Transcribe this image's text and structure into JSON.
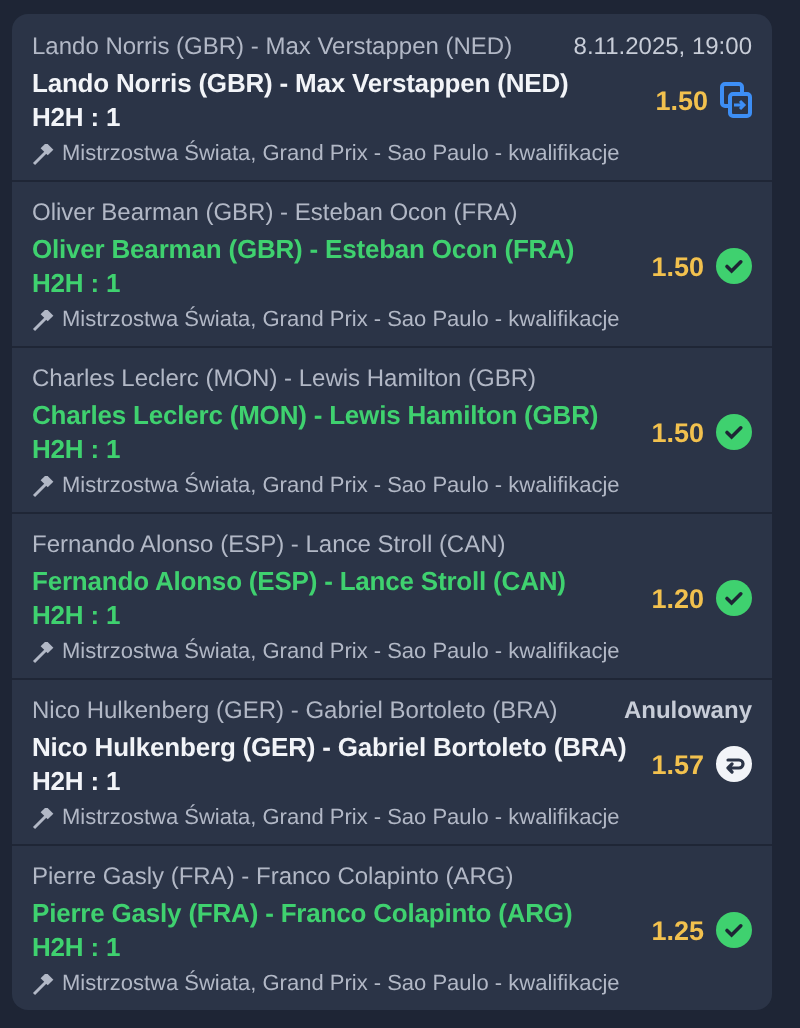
{
  "bets": [
    {
      "event": "Lando Norris (GBR) - Max Verstappen (NED)",
      "note": "8.11.2025, 19:00",
      "selection": "Lando Norris (GBR) - Max Verstappen (NED)",
      "market": "H2H : 1",
      "odds": "1.50",
      "kind": "pending",
      "league": "Mistrzostwa Świata, Grand Prix - Sao Paulo - kwalifikacje"
    },
    {
      "event": "Oliver Bearman (GBR) - Esteban Ocon (FRA)",
      "selection": "Oliver Bearman (GBR) - Esteban Ocon (FRA)",
      "market": "H2H : 1",
      "odds": "1.50",
      "kind": "won",
      "league": "Mistrzostwa Świata, Grand Prix - Sao Paulo - kwalifikacje"
    },
    {
      "event": "Charles Leclerc (MON) - Lewis Hamilton (GBR)",
      "selection": "Charles Leclerc (MON) - Lewis Hamilton (GBR)",
      "market": "H2H : 1",
      "odds": "1.50",
      "kind": "won",
      "league": "Mistrzostwa Świata, Grand Prix - Sao Paulo - kwalifikacje"
    },
    {
      "event": "Fernando Alonso (ESP) - Lance Stroll (CAN)",
      "selection": "Fernando Alonso (ESP) - Lance Stroll (CAN)",
      "market": "H2H : 1",
      "odds": "1.20",
      "kind": "won",
      "league": "Mistrzostwa Świata, Grand Prix - Sao Paulo - kwalifikacje"
    },
    {
      "event": "Nico Hulkenberg (GER) - Gabriel Bortoleto (BRA)",
      "note": "Anulowany",
      "selection": "Nico Hulkenberg (GER) - Gabriel Bortoleto (BRA)",
      "market": "H2H : 1",
      "odds": "1.57",
      "kind": "void",
      "league": "Mistrzostwa Świata, Grand Prix - Sao Paulo - kwalifikacje"
    },
    {
      "event": "Pierre Gasly (FRA) - Franco Colapinto (ARG)",
      "selection": "Pierre Gasly (FRA) - Franco Colapinto (ARG)",
      "market": "H2H : 1",
      "odds": "1.25",
      "kind": "won",
      "league": "Mistrzostwa Świata, Grand Prix - Sao Paulo - kwalifikacje"
    }
  ]
}
